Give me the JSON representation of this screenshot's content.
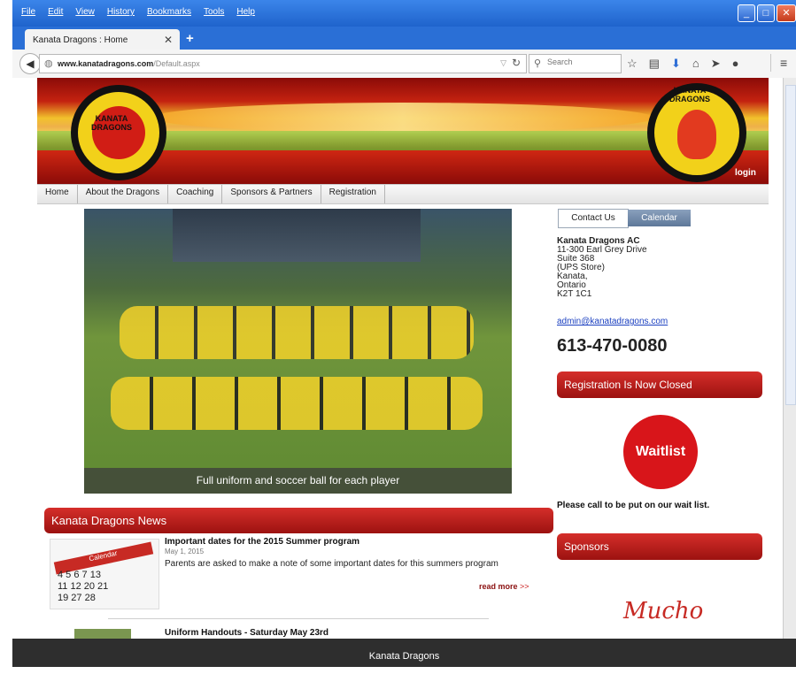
{
  "browser": {
    "menu": [
      "File",
      "Edit",
      "View",
      "History",
      "Bookmarks",
      "Tools",
      "Help"
    ],
    "tab_title": "Kanata Dragons : Home",
    "url_domain": "www.kanatadragons.com",
    "url_path": "/Default.aspx",
    "search_placeholder": "Search"
  },
  "site": {
    "login": "login",
    "nav": [
      "Home",
      "About the Dragons",
      "Coaching",
      "Sponsors & Partners",
      "Registration"
    ],
    "logo_text_left": "KANATA DRAGONS",
    "logo_text_right": "KANATA DRAGONS",
    "photo_caption": "Full uniform and soccer ball for each player",
    "news": {
      "heading": "Kanata Dragons News",
      "calendar_label": "Calendar",
      "items": [
        {
          "title": "Important dates for the 2015 Summer program",
          "date": "May 1, 2015",
          "text": "Parents are asked to make a note of some important dates for this summers program",
          "read_more": "read more",
          "read_more_arrow": ">>"
        },
        {
          "title": "Uniform Handouts - Saturday May 23rd"
        }
      ]
    },
    "contact": {
      "tab_contact": "Contact Us",
      "tab_calendar": "Calendar",
      "org": "Kanata Dragons AC",
      "address": [
        "11-300 Earl Grey Drive",
        "Suite 368",
        "(UPS Store)",
        "Kanata,",
        "Ontario",
        "K2T 1C1"
      ],
      "email": "admin@kanatadragons.com",
      "phone": "613-470-0080"
    },
    "registration_heading": "Registration Is Now Closed",
    "waitlist_button": "Waitlist",
    "call_note": "Please call to be put on our wait list.",
    "sponsors_heading": "Sponsors",
    "sponsor_logo_text": "Mucho"
  },
  "footer": "Kanata Dragons"
}
